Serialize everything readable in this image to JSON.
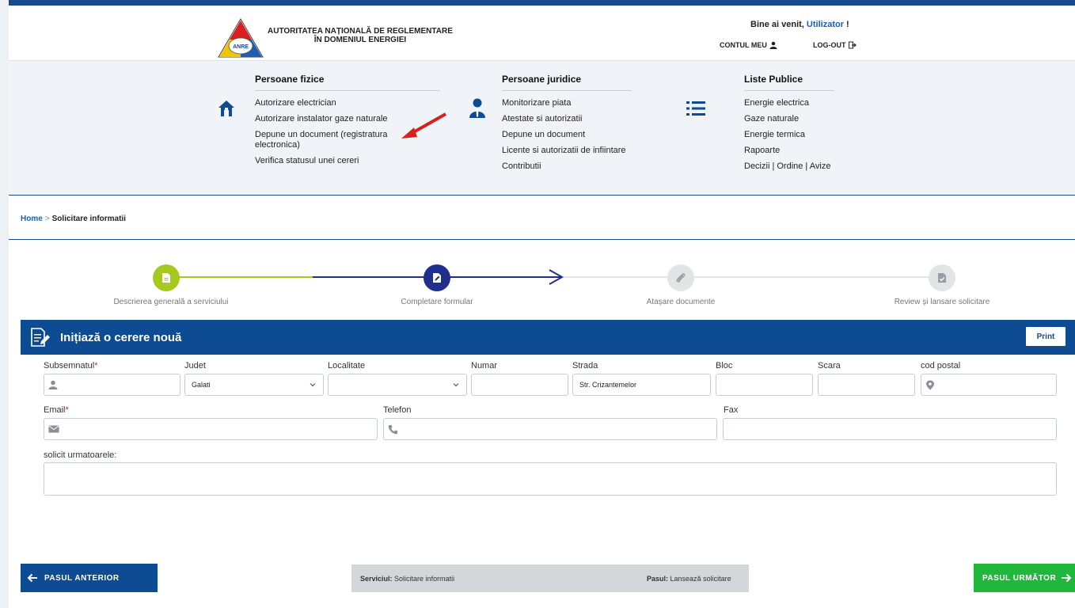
{
  "header": {
    "org_line1": "AUTORITATEA NAȚIONALĂ DE REGLEMENTARE",
    "org_line2": "ÎN DOMENIUL ENERGIEI",
    "logo_text": "ANRE",
    "welcome_prefix": "Bine ai venit, ",
    "welcome_user": "Utilizator",
    "welcome_suffix": " !",
    "account_label": "CONTUL MEU",
    "logout_label": "LOG-OUT"
  },
  "nav": {
    "col1": {
      "title": "Persoane fizice",
      "items": [
        "Autorizare electrician",
        "Autorizare instalator gaze naturale",
        "Depune un document (registratura electronica)",
        "Verifica statusul unei cereri"
      ]
    },
    "col2": {
      "title": "Persoane juridice",
      "items": [
        "Monitorizare piata",
        "Atestate si autorizatii",
        "Depune un document",
        "Licente si autorizatii de infiintare",
        "Contributii"
      ]
    },
    "col3": {
      "title": "Liste Publice",
      "items": [
        "Energie electrica",
        "Gaze naturale",
        "Energie termica",
        "Rapoarte",
        "Decizii | Ordine | Avize"
      ]
    }
  },
  "breadcrumb": {
    "home": "Home",
    "separator": ">",
    "current": "Solicitare informatii"
  },
  "steps": [
    {
      "label": "Descrierea generală a serviciului"
    },
    {
      "label": "Completare formular"
    },
    {
      "label": "Atașare documente"
    },
    {
      "label": "Review și lansare solicitare"
    }
  ],
  "form": {
    "title": "Inițiază o cerere nouă",
    "print_label": "Print",
    "labels": {
      "subsemnatul": "Subsemnatul",
      "judet": "Judet",
      "localitate": "Localitate",
      "numar": "Numar",
      "strada": "Strada",
      "bloc": "Bloc",
      "scara": "Scara",
      "cod_postal": "cod postal",
      "email": "Email",
      "telefon": "Telefon",
      "fax": "Fax",
      "solicit": "solicit urmatoarele:"
    },
    "required_mark": "*",
    "values": {
      "judet": "Galati",
      "strada": "Str. Crizantemelor"
    }
  },
  "footer": {
    "prev_label": "PASUL ANTERIOR",
    "next_label": "PASUL URMĂTOR",
    "service_label": "Serviciul:",
    "service_value": "Solicitare informatii",
    "step_label": "Pasul:",
    "step_value": "Lansează solicitare"
  },
  "colors": {
    "brand_blue": "#0d4c92",
    "step_green": "#a6c920",
    "next_green": "#1fb83c",
    "arrow_red": "#d8211e"
  }
}
